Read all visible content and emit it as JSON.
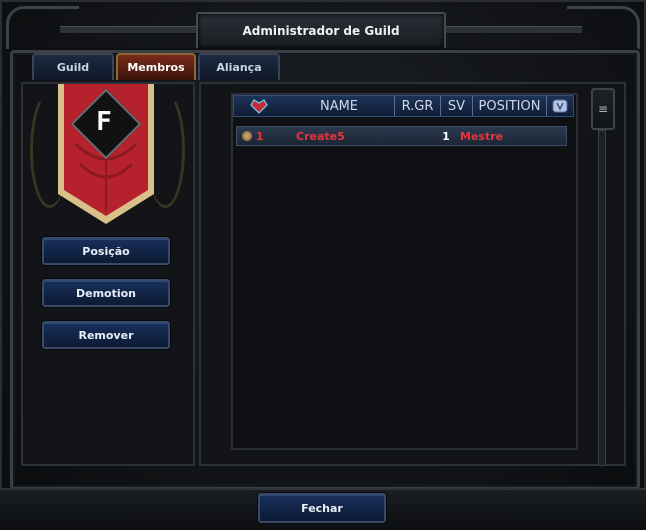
{
  "window": {
    "title": "Administrador de Guild"
  },
  "tabs": [
    {
      "label": "Guild",
      "active": false
    },
    {
      "label": "Membros",
      "active": true
    },
    {
      "label": "Aliança",
      "active": false
    }
  ],
  "emblem": {
    "letter": "F",
    "banner_color": "#b5212d",
    "trim_color": "#d9c08a"
  },
  "actions": {
    "position": "Posição",
    "demotion": "Demotion",
    "remove": "Remover"
  },
  "member_list": {
    "columns": {
      "name": "NAME",
      "rgr": "R.GR",
      "sv": "SV",
      "position": "POSITION"
    },
    "rows": [
      {
        "index": "1",
        "name": "Create5",
        "sv": "1",
        "position": "Mestre"
      }
    ]
  },
  "footer": {
    "close": "Fechar"
  },
  "colors": {
    "accent_red": "#e8353a",
    "button_blue": "#18305a",
    "frame": "#3a3f46"
  }
}
